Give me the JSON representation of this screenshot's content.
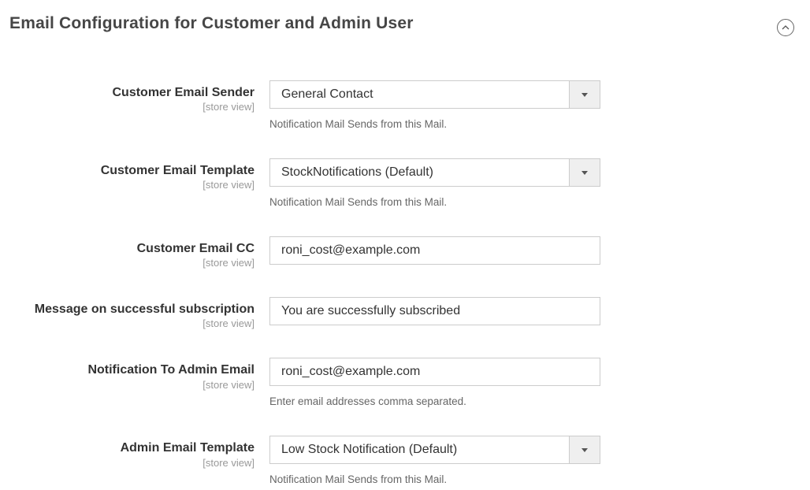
{
  "section": {
    "title": "Email Configuration for Customer and Admin User"
  },
  "fields": {
    "customer_email_sender": {
      "label": "Customer Email Sender",
      "scope": "[store view]",
      "value": "General Contact",
      "note": "Notification Mail Sends from this Mail."
    },
    "customer_email_template": {
      "label": "Customer Email Template",
      "scope": "[store view]",
      "value": "StockNotifications (Default)",
      "note": "Notification Mail Sends from this Mail."
    },
    "customer_email_cc": {
      "label": "Customer Email CC",
      "scope": "[store view]",
      "value": "roni_cost@example.com"
    },
    "message_successful_subscription": {
      "label": "Message on successful subscription",
      "scope": "[store view]",
      "value": "You are successfully subscribed"
    },
    "notification_to_admin_email": {
      "label": "Notification To Admin Email",
      "scope": "[store view]",
      "value": "roni_cost@example.com",
      "note": "Enter email addresses comma separated."
    },
    "admin_email_template": {
      "label": "Admin Email Template",
      "scope": "[store view]",
      "value": "Low Stock Notification (Default)",
      "note": "Notification Mail Sends from this Mail."
    }
  }
}
